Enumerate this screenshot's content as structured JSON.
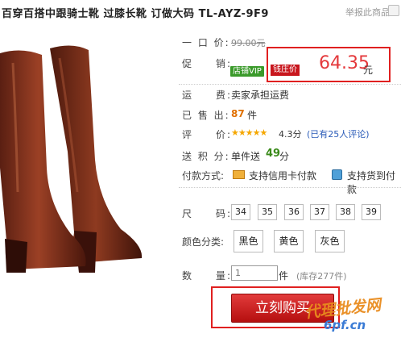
{
  "header": {
    "title": "百穿百搭中跟骑士靴 过膝长靴 订做大码 TL-AYZ-9F9",
    "report_label": "举报此商品"
  },
  "product": {
    "labels": {
      "original_price": "一 口 价:",
      "promotion": "促　　销:",
      "shipping": "运　　费:",
      "sold": "已 售 出:",
      "rating": "评　　价:",
      "points": "送 积 分:",
      "payment": "付款方式:",
      "size": "尺　　码:",
      "color": "颜色分类:",
      "quantity": "数　　量:"
    },
    "original_price": "99.00元",
    "promotion_badge": "店铺VIP",
    "promotion_tag": "钱庄价",
    "promotion_price": "64.35",
    "promotion_unit": "元",
    "shipping_value": "卖家承担运费",
    "sold_count": "87",
    "sold_unit": "件",
    "rating_stars": "★★★★★",
    "rating_value": 4.3,
    "rating_score": "4.3分",
    "rating_reviews": "(已有25人评论)",
    "points_prefix": "单件送",
    "points_value": "49",
    "points_unit": "分",
    "payment_methods": [
      "支持信用卡付款",
      "支持货到付款"
    ],
    "sizes": [
      "34",
      "35",
      "36",
      "37",
      "38",
      "39"
    ],
    "colors": [
      "黑色",
      "黄色",
      "灰色"
    ],
    "quantity_placeholder": "1",
    "quantity_unit": "件",
    "stock_text": "(库存277件)",
    "buy_label": "立刻购买"
  },
  "watermark": {
    "text": "代理批发网",
    "url": "6pf.cn"
  },
  "colors": {
    "accent_red": "#e4393c",
    "badge_green": "#3a9a2a",
    "stock_orange": "#e07000",
    "link_blue": "#2a5bb8"
  }
}
